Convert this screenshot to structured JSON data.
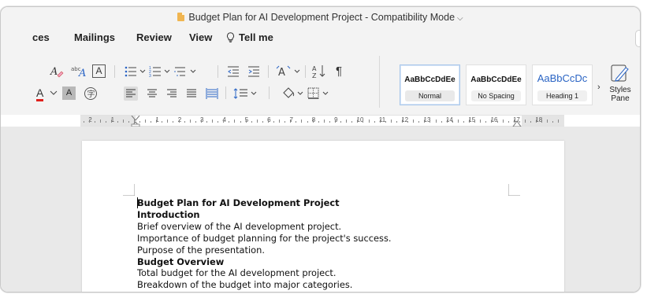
{
  "window": {
    "title": "Budget Plan for AI Development Project  -  Compatibility Mode"
  },
  "tabs": [
    {
      "label": "ces"
    },
    {
      "label": "Mailings"
    },
    {
      "label": "Review"
    },
    {
      "label": "View"
    },
    {
      "label": "Tell me"
    }
  ],
  "toolbar": {
    "font_box_label": "A",
    "sort_label": "A↓Z",
    "pilcrow": "¶"
  },
  "styles": {
    "cards": [
      {
        "sample": "AaBbCcDdEe",
        "name": "Normal",
        "selected": true
      },
      {
        "sample": "AaBbCcDdEe",
        "name": "No Spacing",
        "selected": false
      },
      {
        "sample": "AaBbCcDc",
        "name": "Heading 1",
        "selected": false
      }
    ],
    "pane_label_line1": "Styles",
    "pane_label_line2": "Pane"
  },
  "ruler": {
    "numbers": [
      "2",
      "1",
      "1",
      "2",
      "3",
      "4",
      "5",
      "6",
      "7",
      "8",
      "9",
      "10",
      "11",
      "12",
      "13",
      "14",
      "15",
      "16",
      "17",
      "18"
    ]
  },
  "document": {
    "lines": [
      {
        "text": "Budget Plan for AI Development Project",
        "bold": true
      },
      {
        "text": "Introduction",
        "bold": true
      },
      {
        "text": "Brief overview of the AI development project.",
        "bold": false
      },
      {
        "text": "Importance of budget planning for the project's success.",
        "bold": false
      },
      {
        "text": "Purpose of the presentation.",
        "bold": false
      },
      {
        "text": "Budget Overview",
        "bold": true
      },
      {
        "text": "Total budget for the AI development project.",
        "bold": false
      },
      {
        "text": "Breakdown of the budget into major categories.",
        "bold": false
      }
    ]
  },
  "colors": {
    "ribbon_bg": "#f3f3f3",
    "font_color_underline": "#e0201c",
    "highlight_box": "#b8b8b8",
    "heading_blue": "#2a64c4"
  }
}
